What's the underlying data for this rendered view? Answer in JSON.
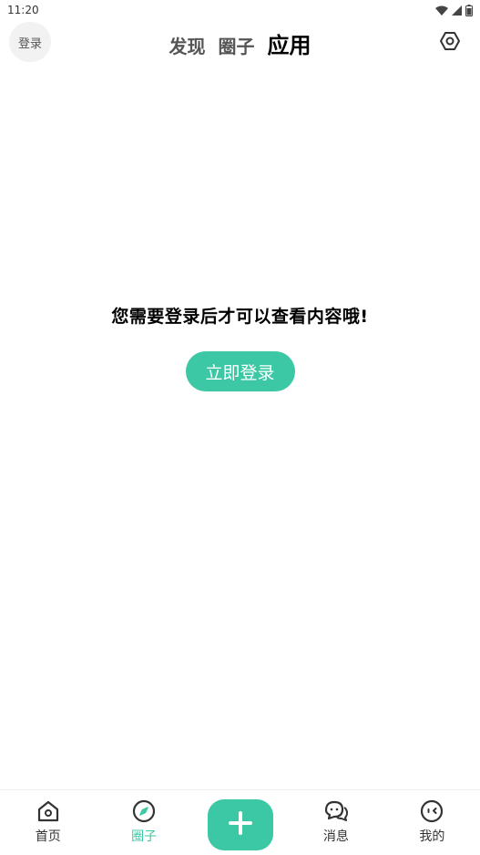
{
  "status_bar": {
    "time": "11:20",
    "icons": [
      "wifi-icon",
      "signal-icon",
      "battery-icon"
    ]
  },
  "header": {
    "login_label": "登录",
    "tabs": [
      {
        "label": "发现",
        "active": false
      },
      {
        "label": "圈子",
        "active": false
      },
      {
        "label": "应用",
        "active": true
      }
    ],
    "settings_icon": "hexagon-settings-icon"
  },
  "main": {
    "message": "您需要登录后才可以查看内容哦!",
    "login_button_label": "立即登录"
  },
  "bottom_nav": {
    "items": [
      {
        "label": "首页",
        "icon": "home-icon",
        "active": false
      },
      {
        "label": "圈子",
        "icon": "compass-icon",
        "active": true
      },
      {
        "label": "",
        "icon": "plus-icon",
        "active": false
      },
      {
        "label": "消息",
        "icon": "chat-bubbles-icon",
        "active": false
      },
      {
        "label": "我的",
        "icon": "face-icon",
        "active": false
      }
    ]
  },
  "colors": {
    "accent": "#3cc8a4",
    "text_primary": "#000000",
    "text_secondary": "#555555",
    "chip_bg": "#f2f2f2"
  }
}
